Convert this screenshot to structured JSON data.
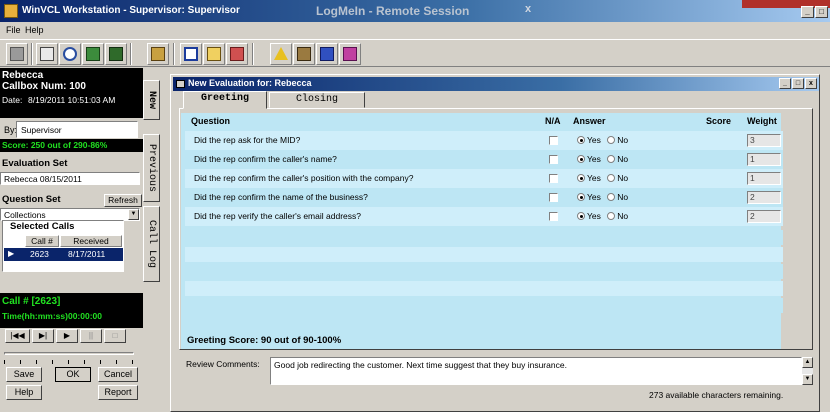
{
  "window": {
    "title": "WinVCL Workstation - Supervisor: Supervisor",
    "logmein": "LogMeIn - Remote Session",
    "close_glyph": "x",
    "controls": [
      "_",
      "□"
    ]
  },
  "menu": [
    "File",
    "Help"
  ],
  "toolbar": {
    "icons": [
      "print-icon",
      "printer-icon",
      "search-icon",
      "phone-icon",
      "book-icon",
      "settings-icon",
      "window-icon",
      "arrow-icon",
      "tools-icon",
      "warning-icon",
      "pencil-icon",
      "monitor-icon",
      "gift-icon"
    ]
  },
  "left": {
    "name": "Rebecca",
    "callbox": "Callbox Num: 100",
    "date_label": "Date:",
    "date_value": "8/19/2011 10:51:03 AM",
    "by_label": "By:",
    "by_value": "Supervisor",
    "score": "Score: 250 out of 290-86%",
    "evaluation_set_label": "Evaluation Set",
    "evaluation_set_value": "Rebecca 08/15/2011",
    "question_set_label": "Question Set",
    "refresh_label": "Refresh",
    "question_set_value": "Collections",
    "selected_calls_label": "Selected Calls",
    "calls_columns": [
      "Call #",
      "Received"
    ],
    "calls": [
      {
        "call": "2623",
        "received": "8/17/2011"
      }
    ],
    "timer_call": "Call # [2623]",
    "timer_time": "Time(hh:mm:ss)00:00:00",
    "save_label": "Save",
    "ok_label": "OK",
    "cancel_label": "Cancel",
    "help_label": "Help",
    "report_label": "Report",
    "side_tabs": [
      "New",
      "Previous",
      "Call Log"
    ]
  },
  "evaluation": {
    "title": "New Evaluation for: Rebecca",
    "tabs": [
      "Greeting",
      "Closing"
    ],
    "columns": {
      "question": "Question",
      "na": "N/A",
      "answer": "Answer",
      "score": "Score",
      "weight": "Weight"
    },
    "yes_label": "Yes",
    "no_label": "No",
    "questions": [
      {
        "text": "Did the rep ask for the MID?",
        "answer": "Yes",
        "weight": "3"
      },
      {
        "text": "Did the rep confirm the caller's name?",
        "answer": "Yes",
        "weight": "1"
      },
      {
        "text": "Did the rep confirm the caller's position with the company?",
        "answer": "Yes",
        "weight": "1"
      },
      {
        "text": "Did the rep confirm the name of the business?",
        "answer": "Yes",
        "weight": "2"
      },
      {
        "text": "Did the rep verify the caller's email address?",
        "answer": "Yes",
        "weight": "2"
      }
    ],
    "greeting_score": "Greeting Score: 90 out of 90-100%",
    "review_label": "Review Comments:",
    "review_text": "Good job redirecting the customer.  Next time suggest that they buy insurance.",
    "chars_remaining": "273 available characters remaining."
  },
  "colors": {
    "titlebar": "#0a246a",
    "panel": "#d4d0c8",
    "grid_light": "#cfeefa",
    "grid": "#bde6f4",
    "score_green": "#21e021"
  }
}
